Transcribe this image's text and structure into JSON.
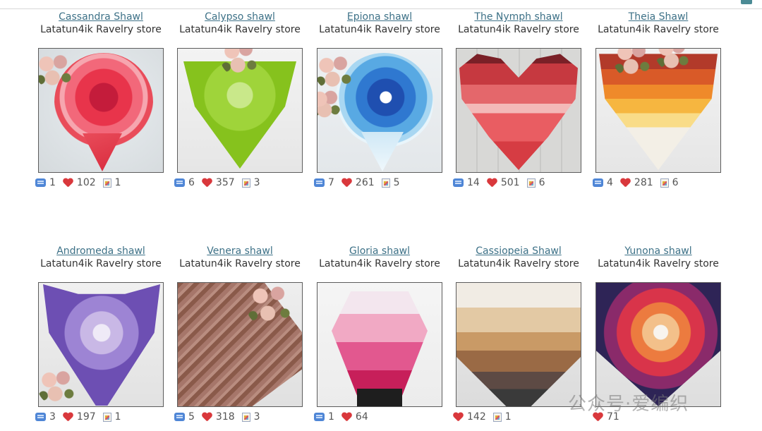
{
  "rows": [
    {
      "cards": [
        {
          "title": "Cassandra Shawl",
          "store": "Latatun4ik Ravelry store",
          "photo_icon": "shawl-photo",
          "stats": {
            "queued": "1",
            "favorites": "102",
            "projects": "1"
          }
        },
        {
          "title": "Calypso shawl",
          "store": "Latatun4ik Ravelry store",
          "photo_icon": "shawl-photo",
          "stats": {
            "queued": "6",
            "favorites": "357",
            "projects": "3"
          }
        },
        {
          "title": "Epiona shawl",
          "store": "Latatun4ik Ravelry store",
          "photo_icon": "shawl-photo",
          "stats": {
            "queued": "7",
            "favorites": "261",
            "projects": "5"
          }
        },
        {
          "title": "The Nymph shawl",
          "store": "Latatun4ik Ravelry store",
          "photo_icon": "shawl-photo",
          "stats": {
            "queued": "14",
            "favorites": "501",
            "projects": "6"
          }
        },
        {
          "title": "Theia Shawl",
          "store": "Latatun4ik Ravelry store",
          "photo_icon": "shawl-photo",
          "stats": {
            "queued": "4",
            "favorites": "281",
            "projects": "6"
          }
        }
      ]
    },
    {
      "cards": [
        {
          "title": "Andromeda shawl",
          "store": "Latatun4ik Ravelry store",
          "photo_icon": "shawl-photo",
          "stats": {
            "queued": "3",
            "favorites": "197",
            "projects": "1"
          }
        },
        {
          "title": "Venera shawl",
          "store": "Latatun4ik Ravelry store",
          "photo_icon": "shawl-photo",
          "stats": {
            "queued": "5",
            "favorites": "318",
            "projects": "3"
          }
        },
        {
          "title": "Gloria shawl",
          "store": "Latatun4ik Ravelry store",
          "photo_icon": "shawl-photo",
          "stats": {
            "queued": "1",
            "favorites": "64",
            "projects": null
          }
        },
        {
          "title": "Cassiopeia Shawl",
          "store": "Latatun4ik Ravelry store",
          "photo_icon": "shawl-photo",
          "stats": {
            "queued": null,
            "favorites": "142",
            "projects": "1"
          }
        },
        {
          "title": "Yunona shawl",
          "store": "Latatun4ik Ravelry store",
          "photo_icon": "shawl-photo",
          "stats": {
            "queued": null,
            "favorites": "71",
            "projects": null
          }
        }
      ]
    }
  ],
  "icons": {
    "queued": "queue-icon",
    "favorites": "heart-icon",
    "projects": "project-icon"
  },
  "colors": {
    "link": "#3d7187",
    "heart": "#d9383c",
    "queue": "#4f86d6"
  },
  "watermark": "公众号·爱编织"
}
